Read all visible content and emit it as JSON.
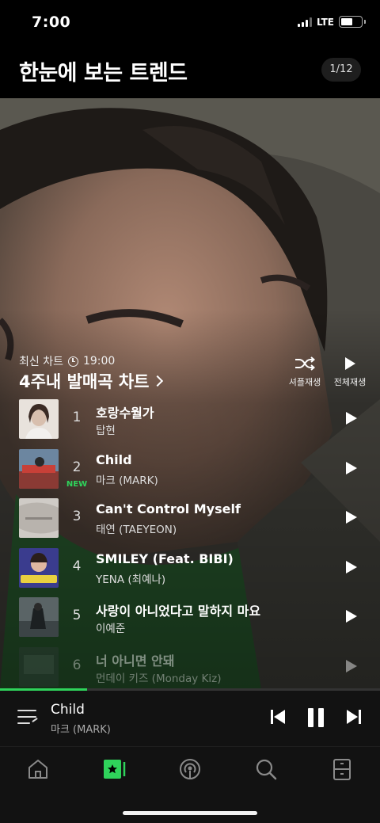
{
  "status": {
    "time": "7:00",
    "network": "LTE"
  },
  "header": {
    "title": "한눈에 보는 트렌드",
    "page_indicator": "1/12"
  },
  "chart": {
    "meta_label": "최신 차트",
    "update_time": "19:00",
    "title": "4주내 발매곡 차트",
    "shuffle_label": "셔플재생",
    "play_all_label": "전체재생"
  },
  "tracks": [
    {
      "rank": "1",
      "title": "호랑수월가",
      "artist": "탑현",
      "badge": ""
    },
    {
      "rank": "2",
      "title": "Child",
      "artist": "마크 (MARK)",
      "badge": "NEW"
    },
    {
      "rank": "3",
      "title": "Can't Control Myself",
      "artist": "태연 (TAEYEON)",
      "badge": ""
    },
    {
      "rank": "4",
      "title": "SMILEY (Feat. BIBI)",
      "artist": "YENA (최예나)",
      "badge": ""
    },
    {
      "rank": "5",
      "title": "사랑이 아니었다고 말하지 마요",
      "artist": "이예준",
      "badge": ""
    },
    {
      "rank": "6",
      "title": "너 아니면 안돼",
      "artist": "먼데이 키즈 (Monday Kiz)",
      "badge": ""
    }
  ],
  "player": {
    "title": "Child",
    "artist": "마크 (MARK)",
    "progress": 0.23
  },
  "tabs": [
    "home-icon",
    "my-music-icon",
    "podcast-icon",
    "search-icon",
    "storage-icon"
  ],
  "colors": {
    "accent": "#2fd35b",
    "background": "#000000",
    "player_bg": "#121212"
  }
}
